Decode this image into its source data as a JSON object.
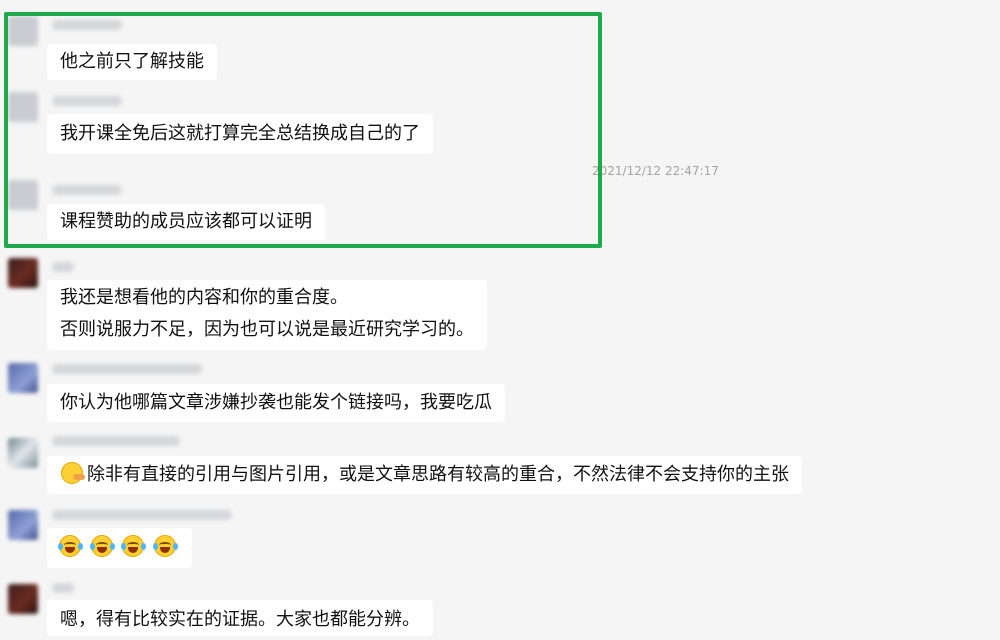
{
  "messages": [
    {
      "text": "他之前只了解技能"
    },
    {
      "text": "我开课全免后这就打算完全总结换成自己的了"
    },
    {
      "text": "课程赞助的成员应该都可以证明"
    },
    {
      "lines": [
        "我还是想看他的内容和你的重合度。",
        "否则说服力不足，因为也可以说是最近研究学习的。"
      ]
    },
    {
      "text": "你认为他哪篇文章涉嫌抄袭也能发个链接吗，我要吃瓜"
    },
    {
      "emoji": "thinking-face-icon",
      "text": "除非有直接的引用与图片引用，或是文章思路有较高的重合，不然法律不会支持你的主张"
    },
    {
      "emojis": [
        "laughing-tears-icon",
        "laughing-tears-icon",
        "laughing-tears-icon",
        "laughing-tears-icon"
      ]
    },
    {
      "text": "嗯，得有比较实在的证据。大家也都能分辨。"
    }
  ],
  "timestamp": "2021/12/12 22:47:17",
  "highlight_color": "#1faa4a"
}
